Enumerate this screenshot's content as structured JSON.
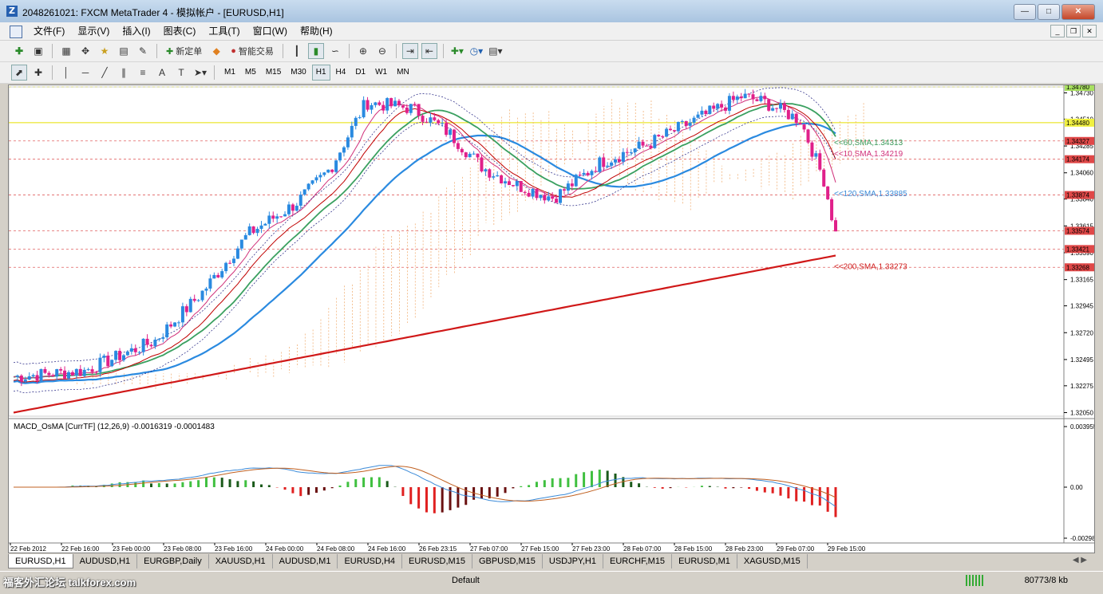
{
  "window": {
    "title": "2048261021: FXCM MetaTrader 4 - 模拟帐户 - [EURUSD,H1]",
    "icon_text": "Z"
  },
  "menu": [
    "文件(F)",
    "显示(V)",
    "插入(I)",
    "图表(C)",
    "工具(T)",
    "窗口(W)",
    "帮助(H)"
  ],
  "toolbar": {
    "new_order": "新定单",
    "expert": "智能交易"
  },
  "timeframes": [
    "M1",
    "M5",
    "M15",
    "M30",
    "H1",
    "H4",
    "D1",
    "W1",
    "MN"
  ],
  "active_timeframe": "H1",
  "chart": {
    "price_ticks": [
      "1.34730",
      "1.34510",
      "1.34285",
      "1.34060",
      "1.33840",
      "1.33615",
      "1.33390",
      "1.33165",
      "1.32945",
      "1.32720",
      "1.32495",
      "1.32275",
      "1.32050"
    ],
    "right_labels": [
      {
        "text": "1.34780",
        "bg": "#a8e060",
        "color": "#000"
      },
      {
        "text": "1.34480",
        "bg": "#f0f040",
        "color": "#000"
      },
      {
        "text": "1.34327",
        "bg": "#e04848",
        "color": "#fff"
      },
      {
        "text": "1.34174",
        "bg": "#e04848",
        "color": "#fff"
      },
      {
        "text": "1.33874",
        "bg": "#e04848",
        "color": "#fff"
      },
      {
        "text": "1.33574",
        "bg": "#e04848",
        "color": "#fff"
      },
      {
        "text": "1.33421",
        "bg": "#e04848",
        "color": "#fff"
      },
      {
        "text": "1.33268",
        "bg": "#e04848",
        "color": "#fff"
      }
    ],
    "ma_labels": [
      {
        "text": "<<60,SMA,1.34313",
        "color": "#3a9a5a"
      },
      {
        "text": "<<10,SMA,1.34219",
        "color": "#d0307a"
      },
      {
        "text": "<<120,SMA,1.33885",
        "color": "#3a8ad8"
      },
      {
        "text": "<<200,SMA,1.33273",
        "color": "#d02020"
      }
    ],
    "indicator_title": "MACD_OsMA [CurrTF] (12,26,9) -0.0016319 -0.0001483",
    "indicator_ticks": [
      "0.003955",
      "0.00",
      "-0.00298"
    ],
    "time_labels": [
      "22 Feb 2012",
      "22 Feb 16:00",
      "23 Feb 00:00",
      "23 Feb 08:00",
      "23 Feb 16:00",
      "24 Feb 00:00",
      "24 Feb 08:00",
      "24 Feb 16:00",
      "26 Feb 23:15",
      "27 Feb 07:00",
      "27 Feb 15:00",
      "27 Feb 23:00",
      "28 Feb 07:00",
      "28 Feb 15:00",
      "28 Feb 23:00",
      "29 Feb 07:00",
      "29 Feb 15:00"
    ]
  },
  "tabs": [
    "EURUSD,H1",
    "AUDUSD,H1",
    "EURGBP,Daily",
    "XAUUSD,H1",
    "AUDUSD,M1",
    "EURUSD,H4",
    "EURUSD,M15",
    "GBPUSD,M15",
    "USDJPY,H1",
    "EURCHF,M15",
    "EURUSD,M1",
    "XAGUSD,M15"
  ],
  "active_tab": "EURUSD,H1",
  "status": {
    "profile": "Default",
    "traffic": "80773/8 kb"
  },
  "watermark": "福客外汇论坛 talkforex.com"
}
